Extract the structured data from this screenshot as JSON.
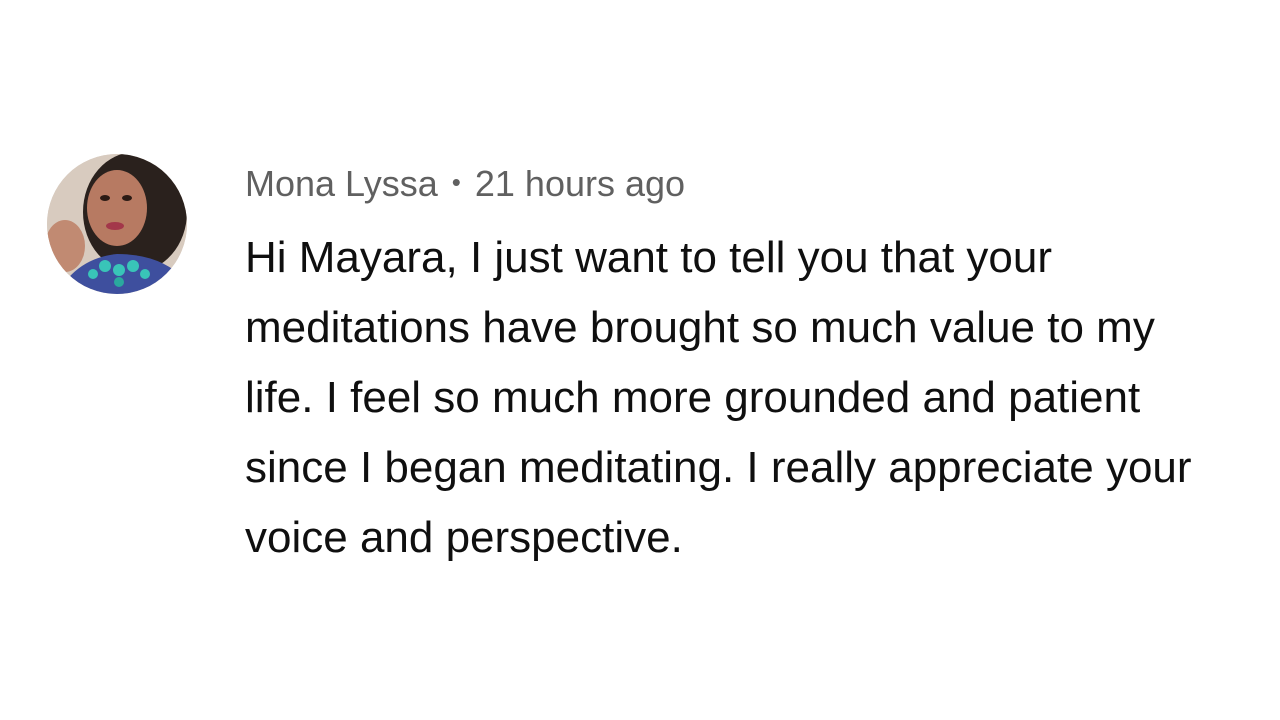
{
  "comment": {
    "author": "Mona Lyssa",
    "separator": "•",
    "timestamp": "21 hours ago",
    "text": "Hi Mayara, I just want to tell you that your meditations have brought so much value to my life. I feel so much more grounded and patient since I began meditating. I really appreciate your voice and perspective."
  }
}
